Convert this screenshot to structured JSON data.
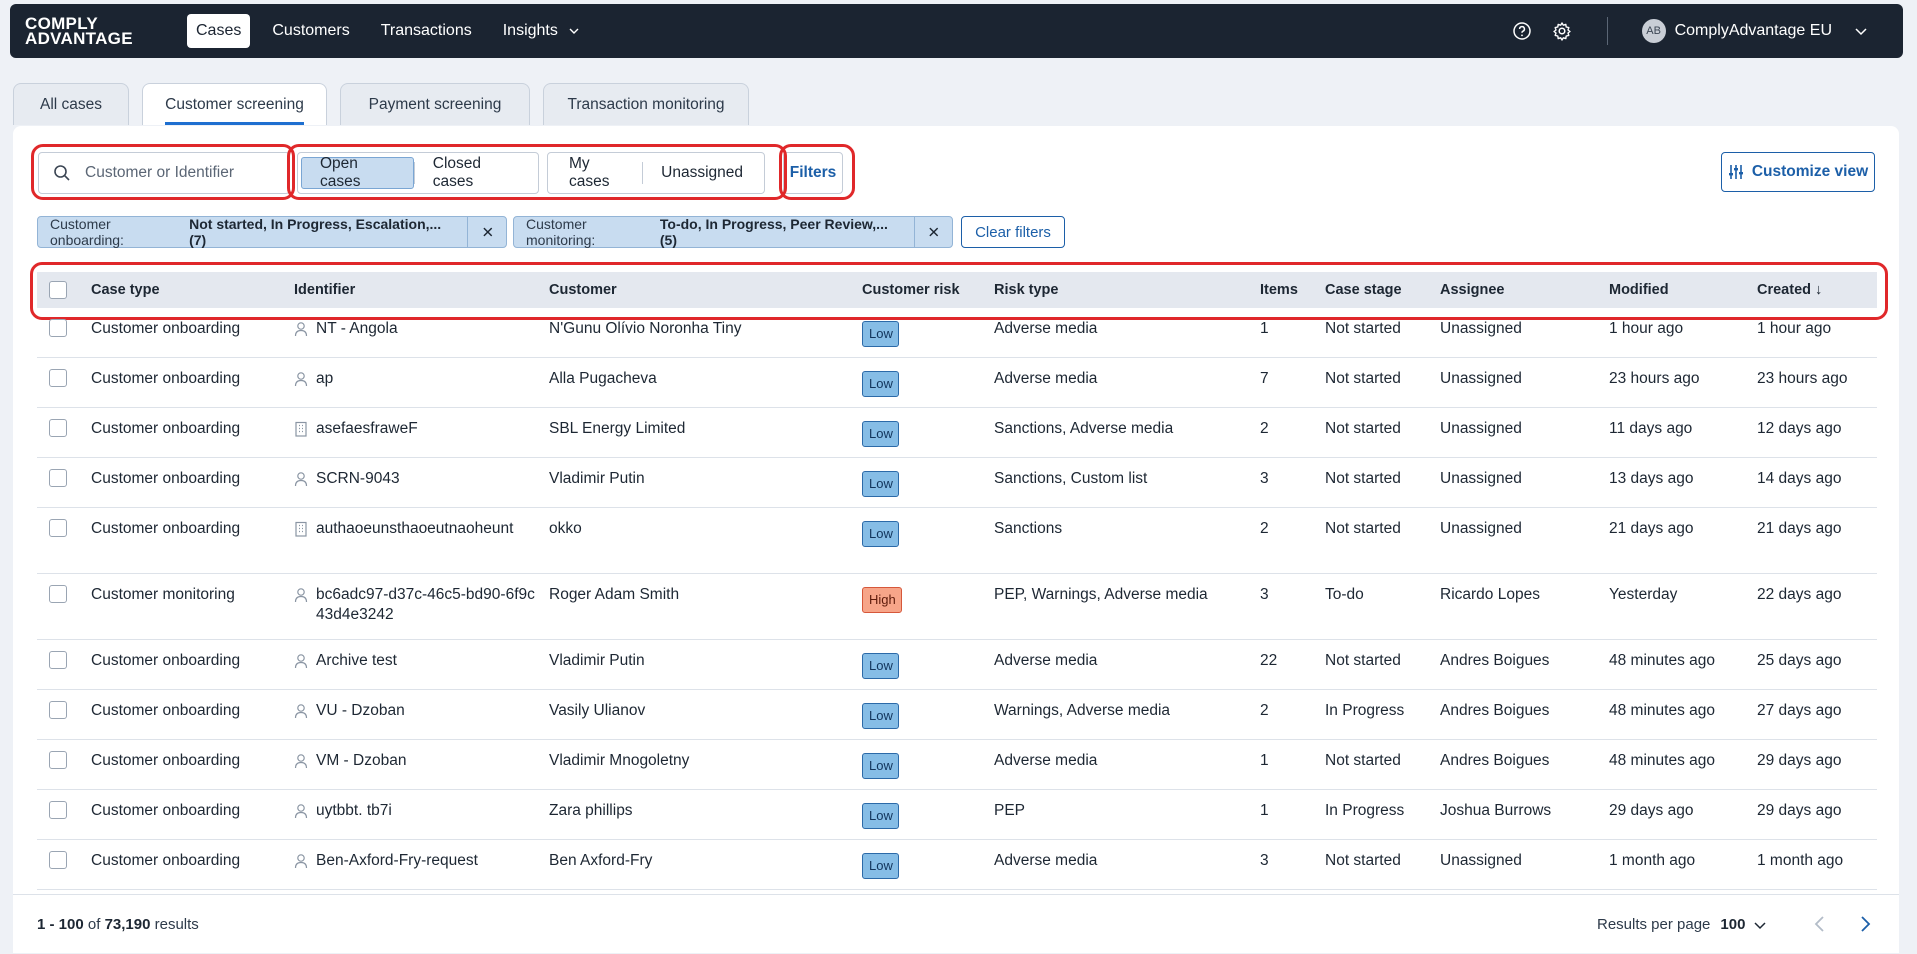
{
  "nav": {
    "logo": "COMPLY ADVANTAGE",
    "links": [
      {
        "label": "Cases",
        "active": true
      },
      {
        "label": "Customers"
      },
      {
        "label": "Transactions"
      },
      {
        "label": "Insights"
      }
    ],
    "avatar_initials": "AB",
    "account_name": "ComplyAdvantage EU"
  },
  "tabs": [
    "All cases",
    "Customer screening",
    "Payment screening",
    "Transaction monitoring"
  ],
  "toolbar": {
    "search_placeholder": "Customer or Identifier",
    "case_status": [
      "Open cases",
      "Closed cases"
    ],
    "assignment": [
      "My cases",
      "Unassigned"
    ],
    "filters_label": "Filters",
    "customize_label": "Customize view"
  },
  "chips": [
    {
      "label": "Customer onboarding:",
      "value": "Not started, In Progress, Escalation,... (7)"
    },
    {
      "label": "Customer monitoring:",
      "value": "To-do, In Progress, Peer Review,... (5)"
    }
  ],
  "clear_filters_label": "Clear filters",
  "table": {
    "columns": [
      "Case type",
      "Identifier",
      "Customer",
      "Customer risk",
      "Risk type",
      "Items",
      "Case stage",
      "Assignee",
      "Modified",
      "Created"
    ],
    "sort_indicator": "↓",
    "rows": [
      {
        "case_type": "Customer onboarding",
        "id_kind": "person",
        "identifier": "NT - Angola",
        "customer": "N'Gunu Olívio Noronha Tiny",
        "risk": "Low",
        "risk_type": "Adverse media",
        "items": "1",
        "stage": "Not started",
        "assignee": "Unassigned",
        "modified": "1 hour ago",
        "created": "1 hour ago"
      },
      {
        "case_type": "Customer onboarding",
        "id_kind": "person",
        "identifier": "ap",
        "customer": "Alla Pugacheva",
        "risk": "Low",
        "risk_type": "Adverse media",
        "items": "7",
        "stage": "Not started",
        "assignee": "Unassigned",
        "modified": "23 hours ago",
        "created": "23 hours ago"
      },
      {
        "case_type": "Customer onboarding",
        "id_kind": "company",
        "identifier": "asefaesfraweF",
        "customer": "SBL Energy Limited",
        "risk": "Low",
        "risk_type": "Sanctions, Adverse media",
        "items": "2",
        "stage": "Not started",
        "assignee": "Unassigned",
        "modified": "11 days ago",
        "created": "12 days ago"
      },
      {
        "case_type": "Customer onboarding",
        "id_kind": "person",
        "identifier": "SCRN-9043",
        "customer": "Vladimir Putin",
        "risk": "Low",
        "risk_type": "Sanctions, Custom list",
        "items": "3",
        "stage": "Not started",
        "assignee": "Unassigned",
        "modified": "13 days ago",
        "created": "14 days ago"
      },
      {
        "case_type": "Customer onboarding",
        "id_kind": "company",
        "identifier": "authaoeunsthaoeutnaoheunt",
        "customer": "okko",
        "risk": "Low",
        "risk_type": "Sanctions",
        "items": "2",
        "stage": "Not started",
        "assignee": "Unassigned",
        "modified": "21 days ago",
        "created": "21 days ago"
      },
      {
        "case_type": "Customer monitoring",
        "id_kind": "person",
        "identifier": "bc6adc97-d37c-46c5-bd90-6f9c43d4e3242",
        "customer": "Roger Adam Smith",
        "risk": "High",
        "risk_type": "PEP, Warnings, Adverse media",
        "items": "3",
        "stage": "To-do",
        "assignee": "Ricardo Lopes",
        "modified": "Yesterday",
        "created": "22 days ago"
      },
      {
        "case_type": "Customer onboarding",
        "id_kind": "person",
        "identifier": "Archive test",
        "customer": "Vladimir Putin",
        "risk": "Low",
        "risk_type": "Adverse media",
        "items": "22",
        "stage": "Not started",
        "assignee": "Andres Boigues",
        "modified": "48 minutes ago",
        "created": "25 days ago"
      },
      {
        "case_type": "Customer onboarding",
        "id_kind": "person",
        "identifier": "VU - Dzoban",
        "customer": "Vasily Ulianov",
        "risk": "Low",
        "risk_type": "Warnings, Adverse media",
        "items": "2",
        "stage": "In Progress",
        "assignee": "Andres Boigues",
        "modified": "48 minutes ago",
        "created": "27 days ago"
      },
      {
        "case_type": "Customer onboarding",
        "id_kind": "person",
        "identifier": "VM - Dzoban",
        "customer": "Vladimir Mnogoletny",
        "risk": "Low",
        "risk_type": "Adverse media",
        "items": "1",
        "stage": "Not started",
        "assignee": "Andres Boigues",
        "modified": "48 minutes ago",
        "created": "29 days ago"
      },
      {
        "case_type": "Customer onboarding",
        "id_kind": "person",
        "identifier": "uytbbt. tb7i",
        "customer": "Zara phillips",
        "risk": "Low",
        "risk_type": "PEP",
        "items": "1",
        "stage": "In Progress",
        "assignee": "Joshua Burrows",
        "modified": "29 days ago",
        "created": "29 days ago"
      },
      {
        "case_type": "Customer onboarding",
        "id_kind": "person",
        "identifier": "Ben-Axford-Fry-request",
        "customer": "Ben Axford-Fry",
        "risk": "Low",
        "risk_type": "Adverse media",
        "items": "3",
        "stage": "Not started",
        "assignee": "Unassigned",
        "modified": "1 month ago",
        "created": "1 month ago"
      }
    ]
  },
  "footer": {
    "range": "1 - 100",
    "of": "of",
    "total": "73,190",
    "results_word": "results",
    "per_page_label": "Results per page",
    "per_page_value": "100"
  },
  "colors": {
    "nav_bg": "#1b2431",
    "accent": "#1c5fa8",
    "highlight": "#e0282a",
    "risk_low": "#86bde6",
    "risk_high": "#f7a589"
  }
}
